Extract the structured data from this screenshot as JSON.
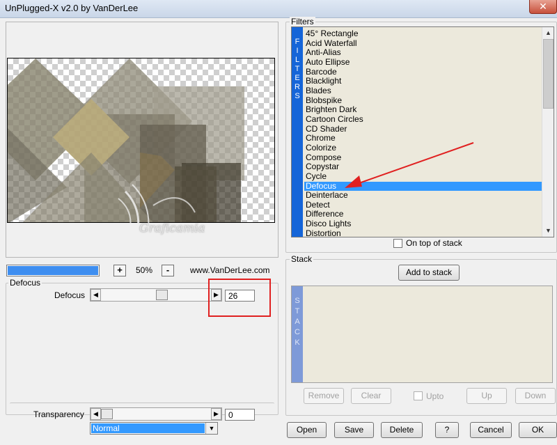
{
  "window": {
    "title": "UnPlugged-X v2.0 by VanDerLee",
    "close_glyph": "✕"
  },
  "preview": {
    "zoom_in": "+",
    "zoom_out": "-",
    "zoom_level": "50%",
    "website": "www.VanDerLee.com",
    "progress_fraction": 1.0,
    "watermark_text": "Graficamia"
  },
  "settings_group": {
    "title": "Defocus",
    "slider_label": "Defocus",
    "slider_value": "26",
    "slider_fraction": 0.55
  },
  "transparency": {
    "label": "Transparency",
    "value": "0",
    "slider_fraction": 0.0
  },
  "blend_mode": {
    "selected": "Normal"
  },
  "filters": {
    "group_title": "Filters",
    "side_label": [
      "F",
      "I",
      "L",
      "T",
      "E",
      "R",
      "S"
    ],
    "items": [
      "45° Rectangle",
      "Acid Waterfall",
      "Anti-Alias",
      "Auto Ellipse",
      "Barcode",
      "Blacklight",
      "Blades",
      "Blobspike",
      "Brighten Dark",
      "Cartoon Circles",
      "CD Shader",
      "Chrome",
      "Colorize",
      "Compose",
      "Copystar",
      "Cycle",
      "Defocus",
      "Deinterlace",
      "Detect",
      "Difference",
      "Disco Lights",
      "Distortion"
    ],
    "selected": "Defocus",
    "on_top_label": "On top of stack"
  },
  "stack": {
    "group_title": "Stack",
    "add_button": "Add to stack",
    "side_label": [
      "S",
      "T",
      "A",
      "C",
      "K"
    ],
    "remove": "Remove",
    "clear": "Clear",
    "upto": "Upto",
    "up": "Up",
    "down": "Down"
  },
  "footer": {
    "open": "Open",
    "save": "Save",
    "delete": "Delete",
    "help": "?",
    "cancel": "Cancel",
    "ok": "OK"
  },
  "colors": {
    "selection": "#3399ff",
    "filters_sidebar": "#1565d8",
    "stack_sidebar": "#7e9ad8",
    "list_background": "#ece9dc",
    "annotation": "#e02020"
  }
}
